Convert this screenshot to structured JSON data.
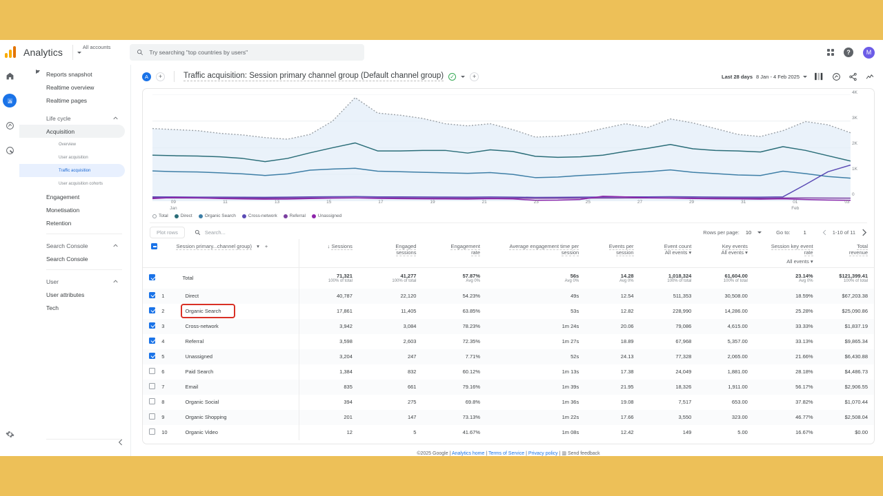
{
  "topbar": {
    "brand": "Analytics",
    "account_selector": "All accounts",
    "search_placeholder": "Try searching \"top countries by users\"",
    "avatar_initial": "M",
    "help_label": "?"
  },
  "rail": {
    "items": [
      {
        "name": "home-icon",
        "label": "Home"
      },
      {
        "name": "reports-icon",
        "label": "Reports"
      },
      {
        "name": "explore-icon",
        "label": "Explore"
      },
      {
        "name": "advertising-icon",
        "label": "Advertising"
      },
      {
        "name": "admin-gear-icon",
        "label": "Admin"
      }
    ]
  },
  "sidebar": {
    "items": [
      {
        "label": "Reports snapshot",
        "type": "item"
      },
      {
        "label": "Realtime overview",
        "type": "item"
      },
      {
        "label": "Realtime pages",
        "type": "item"
      },
      {
        "label": "Life cycle",
        "type": "group"
      },
      {
        "label": "Acquisition",
        "type": "item-expanded"
      },
      {
        "label": "Overview",
        "type": "sub"
      },
      {
        "label": "User acquisition",
        "type": "sub"
      },
      {
        "label": "Traffic acquisition",
        "type": "sub-selected"
      },
      {
        "label": "User acquisition cohorts",
        "type": "sub"
      },
      {
        "label": "Engagement",
        "type": "item-collapsed"
      },
      {
        "label": "Monetisation",
        "type": "item-collapsed"
      },
      {
        "label": "Retention",
        "type": "item"
      },
      {
        "label": "Search Console",
        "type": "group"
      },
      {
        "label": "Search Console",
        "type": "item-collapsed"
      },
      {
        "label": "User",
        "type": "group"
      },
      {
        "label": "User attributes",
        "type": "item-collapsed"
      },
      {
        "label": "Tech",
        "type": "item-collapsed"
      }
    ]
  },
  "page": {
    "badge": "A",
    "add_comparison": "+",
    "title": "Traffic acquisition: Session primary channel group (Default channel group)",
    "save_check": "✓",
    "add_button": "+",
    "date_label": "Last 28 days",
    "date_range": "8 Jan - 4 Feb 2025",
    "actions": [
      "compare-icon",
      "insights-icon",
      "share-icon",
      "trend-icon"
    ]
  },
  "chart_data": {
    "type": "line",
    "title": "",
    "xlabel": "",
    "ylabel": "",
    "ylim": [
      0,
      4000
    ],
    "yticks": [
      "0",
      "1K",
      "2K",
      "3K",
      "4K"
    ],
    "grid": true,
    "legend_position": "bottom",
    "x": [
      "09\nJan",
      "",
      "11",
      "",
      "13",
      "",
      "15",
      "",
      "17",
      "",
      "19",
      "",
      "21",
      "",
      "23",
      "",
      "25",
      "",
      "27",
      "",
      "29",
      "",
      "31",
      "",
      "01\nFeb",
      "",
      "03",
      ""
    ],
    "xtick_labels": [
      "09\nJan",
      "11",
      "13",
      "15",
      "17",
      "19",
      "21",
      "23",
      "25",
      "27",
      "29",
      "31",
      "01\nFeb",
      "03"
    ],
    "series": [
      {
        "name": "Total",
        "color": "#9aa0a6",
        "style": "dotted",
        "values": [
          2720,
          2680,
          2640,
          2540,
          2480,
          2380,
          2320,
          2500,
          3000,
          3880,
          3300,
          3220,
          3100,
          2900,
          2820,
          2900,
          2680,
          2400,
          2430,
          2530,
          2720,
          2900,
          2760,
          3080,
          2930,
          2720,
          2500,
          2420,
          2640,
          2980,
          2860,
          2560
        ]
      },
      {
        "name": "Direct",
        "color": "#2a6d78",
        "style": "solid",
        "values": [
          1720,
          1700,
          1690,
          1660,
          1600,
          1480,
          1600,
          1810,
          2000,
          2180,
          1880,
          1880,
          1900,
          1900,
          1800,
          1920,
          1860,
          1680,
          1640,
          1660,
          1720,
          1860,
          1980,
          2120,
          1960,
          1900,
          1880,
          1840,
          2040,
          1900,
          1700,
          1500
        ]
      },
      {
        "name": "Organic Search",
        "color": "#3d7ea6",
        "style": "solid",
        "values": [
          1130,
          1100,
          1090,
          1060,
          1020,
          960,
          1020,
          1160,
          1200,
          1230,
          1120,
          1100,
          1080,
          1060,
          1040,
          1070,
          1000,
          880,
          900,
          960,
          1000,
          1060,
          1100,
          1170,
          1080,
          1030,
          980,
          960,
          1120,
          1030,
          920,
          860
        ]
      },
      {
        "name": "Cross-network",
        "color": "#5b4bb5",
        "style": "solid",
        "values": [
          160,
          155,
          150,
          148,
          145,
          142,
          150,
          160,
          165,
          170,
          160,
          158,
          155,
          152,
          150,
          155,
          150,
          140,
          142,
          148,
          152,
          158,
          160,
          165,
          158,
          152,
          150,
          148,
          160,
          620,
          1100,
          1350
        ]
      },
      {
        "name": "Referral",
        "color": "#7b3fa0",
        "style": "solid",
        "values": [
          120,
          118,
          115,
          112,
          110,
          108,
          112,
          118,
          120,
          122,
          118,
          116,
          115,
          112,
          110,
          114,
          110,
          104,
          106,
          110,
          112,
          116,
          118,
          120,
          116,
          112,
          110,
          108,
          116,
          118,
          115,
          110
        ]
      },
      {
        "name": "Unassigned",
        "color": "#8e24aa",
        "style": "solid",
        "values": [
          90,
          140,
          120,
          95,
          80,
          70,
          75,
          95,
          110,
          120,
          100,
          90,
          85,
          80,
          75,
          90,
          80,
          30,
          35,
          60,
          180,
          160,
          120,
          110,
          95,
          85,
          80,
          70,
          85,
          60,
          40,
          30
        ]
      }
    ]
  },
  "table_toolbar": {
    "plot_rows": "Plot rows",
    "search_placeholder": "Search...",
    "rows_per_page_label": "Rows per page:",
    "rows_per_page_value": "10",
    "goto_label": "Go to:",
    "goto_value": "1",
    "range": "1-10 of 11"
  },
  "table": {
    "dimension_header": "Session primary...channel group)",
    "columns": [
      {
        "id": "sessions",
        "label": "Sessions",
        "sorted": true,
        "sub": ""
      },
      {
        "id": "engaged_sessions",
        "label": "Engaged\nsessions",
        "sub": ""
      },
      {
        "id": "engagement_rate",
        "label": "Engagement\nrate",
        "sub": ""
      },
      {
        "id": "avg_engagement_time",
        "label": "Average engagement time per\nsession",
        "sub": ""
      },
      {
        "id": "events_per_session",
        "label": "Events per\nsession",
        "sub": ""
      },
      {
        "id": "event_count",
        "label": "Event count",
        "sub": "All events"
      },
      {
        "id": "key_events",
        "label": "Key events",
        "sub": "All events"
      },
      {
        "id": "session_key_event_rate",
        "label": "Session key event\nrate",
        "sub": "All events"
      },
      {
        "id": "total_revenue",
        "label": "Total\nrevenue",
        "sub": ""
      }
    ],
    "total_row": {
      "label": "Total",
      "checked": true,
      "values": [
        "71,321",
        "41,277",
        "57.87%",
        "56s",
        "14.28",
        "1,018,324",
        "61,604.00",
        "23.14%",
        "$121,399.41"
      ],
      "subvalues": [
        "100% of total",
        "100% of total",
        "Avg 0%",
        "Avg 0%",
        "Avg 0%",
        "100% of total",
        "100% of total",
        "Avg 0%",
        "100% of total"
      ]
    },
    "rows": [
      {
        "n": "1",
        "label": "Direct",
        "checked": true,
        "highlighted": false,
        "values": [
          "40,787",
          "22,120",
          "54.23%",
          "49s",
          "12.54",
          "511,353",
          "30,508.00",
          "18.59%",
          "$67,203.38"
        ]
      },
      {
        "n": "2",
        "label": "Organic Search",
        "checked": true,
        "highlighted": true,
        "values": [
          "17,861",
          "11,405",
          "63.85%",
          "53s",
          "12.82",
          "228,990",
          "14,286.00",
          "25.28%",
          "$25,090.86"
        ]
      },
      {
        "n": "3",
        "label": "Cross-network",
        "checked": true,
        "highlighted": false,
        "values": [
          "3,942",
          "3,084",
          "78.23%",
          "1m 24s",
          "20.06",
          "79,086",
          "4,615.00",
          "33.33%",
          "$1,837.19"
        ]
      },
      {
        "n": "4",
        "label": "Referral",
        "checked": true,
        "highlighted": false,
        "values": [
          "3,598",
          "2,603",
          "72.35%",
          "1m 27s",
          "18.89",
          "67,968",
          "5,357.00",
          "33.13%",
          "$9,865.34"
        ]
      },
      {
        "n": "5",
        "label": "Unassigned",
        "checked": true,
        "highlighted": false,
        "values": [
          "3,204",
          "247",
          "7.71%",
          "52s",
          "24.13",
          "77,328",
          "2,065.00",
          "21.66%",
          "$6,430.88"
        ]
      },
      {
        "n": "6",
        "label": "Paid Search",
        "checked": false,
        "highlighted": false,
        "values": [
          "1,384",
          "832",
          "60.12%",
          "1m 13s",
          "17.38",
          "24,049",
          "1,881.00",
          "28.18%",
          "$4,486.73"
        ]
      },
      {
        "n": "7",
        "label": "Email",
        "checked": false,
        "highlighted": false,
        "values": [
          "835",
          "661",
          "79.16%",
          "1m 39s",
          "21.95",
          "18,326",
          "1,911.00",
          "56.17%",
          "$2,906.55"
        ]
      },
      {
        "n": "8",
        "label": "Organic Social",
        "checked": false,
        "highlighted": false,
        "values": [
          "394",
          "275",
          "69.8%",
          "1m 36s",
          "19.08",
          "7,517",
          "653.00",
          "37.82%",
          "$1,070.44"
        ]
      },
      {
        "n": "9",
        "label": "Organic Shopping",
        "checked": false,
        "highlighted": false,
        "values": [
          "201",
          "147",
          "73.13%",
          "1m 22s",
          "17.66",
          "3,550",
          "323.00",
          "46.77%",
          "$2,508.04"
        ]
      },
      {
        "n": "10",
        "label": "Organic Video",
        "checked": false,
        "highlighted": false,
        "values": [
          "12",
          "5",
          "41.67%",
          "1m 08s",
          "12.42",
          "149",
          "5.00",
          "16.67%",
          "$0.00"
        ]
      }
    ]
  },
  "footer": {
    "copyright": "©2025 Google",
    "links": [
      "Analytics home",
      "Terms of Service",
      "Privacy policy"
    ],
    "feedback": "Send feedback"
  },
  "colors": {
    "accent": "#1a73e8",
    "brand_yellow": "#edc058",
    "highlight_red": "#d93025",
    "total": "#9aa0a6",
    "direct": "#2a6d78",
    "organic_search": "#3d7ea6",
    "cross_network": "#5b4bb5",
    "referral": "#7b3fa0",
    "unassigned": "#8e24aa"
  }
}
